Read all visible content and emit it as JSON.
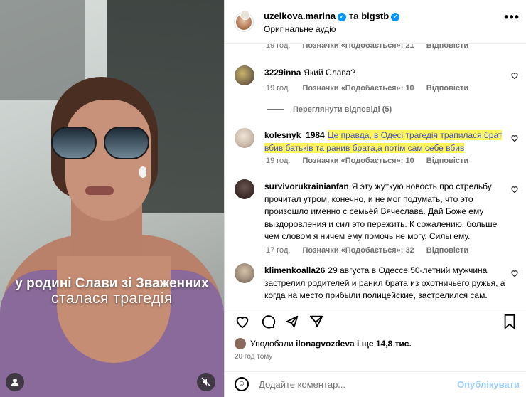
{
  "video": {
    "caption_line1": "у родині Слави зі Зваженних",
    "caption_line2": "сталася трагедія",
    "user_icon": "user-icon",
    "mute_icon": "speaker-muted-icon"
  },
  "header": {
    "user1": "uzelkova.marina",
    "connector": "та",
    "user2": "bigstb",
    "audio": "Оригінальне аудіо",
    "more": "•••"
  },
  "comments": [
    {
      "user": "",
      "text": "",
      "time": "19 год.",
      "likes": "Позначки «Подобається»: 21",
      "reply": "Відповісти",
      "avatar_color": "#b8a99a"
    },
    {
      "user": "3229inna",
      "text": "Який Слава?",
      "time": "19 год.",
      "likes": "Позначки «Подобається»: 10",
      "reply": "Відповісти",
      "avatar_color": "#7b6a4d"
    },
    {
      "user": "kolesnyk_1984",
      "text": "Це правда, в Одесі трагедія трапилася,брат вбив батьків та ранив брата,а потім сам себе вбив",
      "time": "19 год.",
      "likes": "Позначки «Подобається»: 10",
      "reply": "Відповісти",
      "avatar_color": "#c9b8a8"
    },
    {
      "user": "survivorukrainianfan",
      "text": "Я эту жуткую новость про стрельбу прочитал утром, конечно, и не мог подумать, что это произошло именно с семьёй Вячеслава. Дай Боже ему выздоровления и сил это пережить. К сожалению, больше чем словом я ничем ему помочь не могу. Силы ему.",
      "time": "17 год.",
      "likes": "Позначки «Подобається»: 32",
      "reply": "Відповісти",
      "avatar_color": "#3d2e2a"
    },
    {
      "user": "klimenkoalla26",
      "text": "29 августа в Одессе 50-летний мужчина застрелил родителей и ранил брата из охотничьего ружья, а когда на место прибыли полицейские, застрелился сам.",
      "avatar_color": "#9a8a78"
    }
  ],
  "view_replies": "Переглянути відповіді (5)",
  "actions": {
    "like_icon": "heart-icon",
    "comment_icon": "comment-icon",
    "share_icon": "share-icon",
    "send_icon": "send-icon",
    "save_icon": "bookmark-icon"
  },
  "likes_summary": {
    "prefix": "Уподобали",
    "user": "ilonagvozdeva",
    "suffix": "і ще 14,8 тис."
  },
  "posted": "20 год тому",
  "add_comment": {
    "placeholder": "Додайте коментар...",
    "post_label": "Опублікувати"
  }
}
